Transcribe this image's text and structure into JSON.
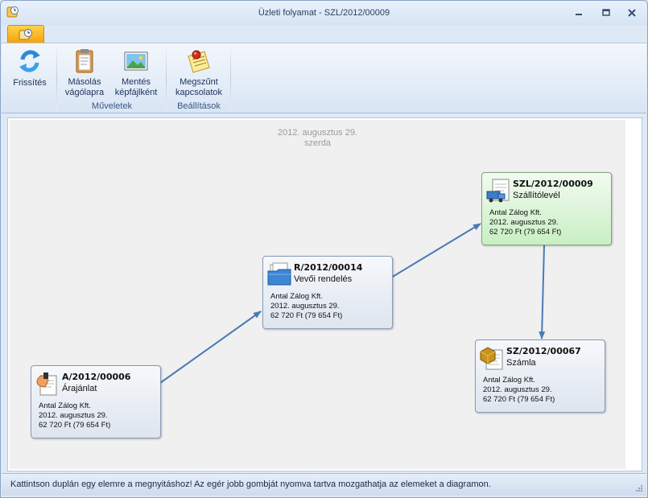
{
  "window": {
    "title": "Üzleti folyamat - SZL/2012/00009"
  },
  "ribbon": {
    "refresh_label": "Frissítés",
    "copy_label_1": "Másolás",
    "copy_label_2": "vágólapra",
    "save_label_1": "Mentés",
    "save_label_2": "képfájlként",
    "lost_label_1": "Megszűnt",
    "lost_label_2": "kapcsolatok",
    "groups": {
      "operations": "Műveletek",
      "settings": "Beállítások"
    }
  },
  "diagram": {
    "date": "2012. augusztus 29.",
    "weekday": "szerda",
    "documents": [
      {
        "number": "A/2012/00006",
        "type": "Árajánlat",
        "partner": "Antal Zálog Kft.",
        "date": "2012. augusztus 29.",
        "amount": "62 720 Ft (79 654 Ft)",
        "icon": "quote-icon"
      },
      {
        "number": "R/2012/00014",
        "type": "Vevői rendelés",
        "partner": "Antal Zálog Kft.",
        "date": "2012. augusztus 29.",
        "amount": "62 720 Ft (79 654 Ft)",
        "icon": "order-folder-icon"
      },
      {
        "number": "SZL/2012/00009",
        "type": "Szállítólevél",
        "partner": "Antal Zálog Kft.",
        "date": "2012. augusztus 29.",
        "amount": "62 720 Ft (79 654 Ft)",
        "icon": "delivery-note-icon",
        "highlighted": true
      },
      {
        "number": "SZ/2012/00067",
        "type": "Számla",
        "partner": "Antal Zálog Kft.",
        "date": "2012. augusztus 29.",
        "amount": "62 720 Ft (79 654 Ft)",
        "icon": "invoice-icon"
      }
    ],
    "arrow_color": "#4a7ab5",
    "highlight_color": "#c9efc4"
  },
  "status": {
    "text": "Kattintson duplán egy elemre a megnyitáshoz! Az egér jobb gombját nyomva tartva mozgathatja az elemeket a diagramon."
  }
}
